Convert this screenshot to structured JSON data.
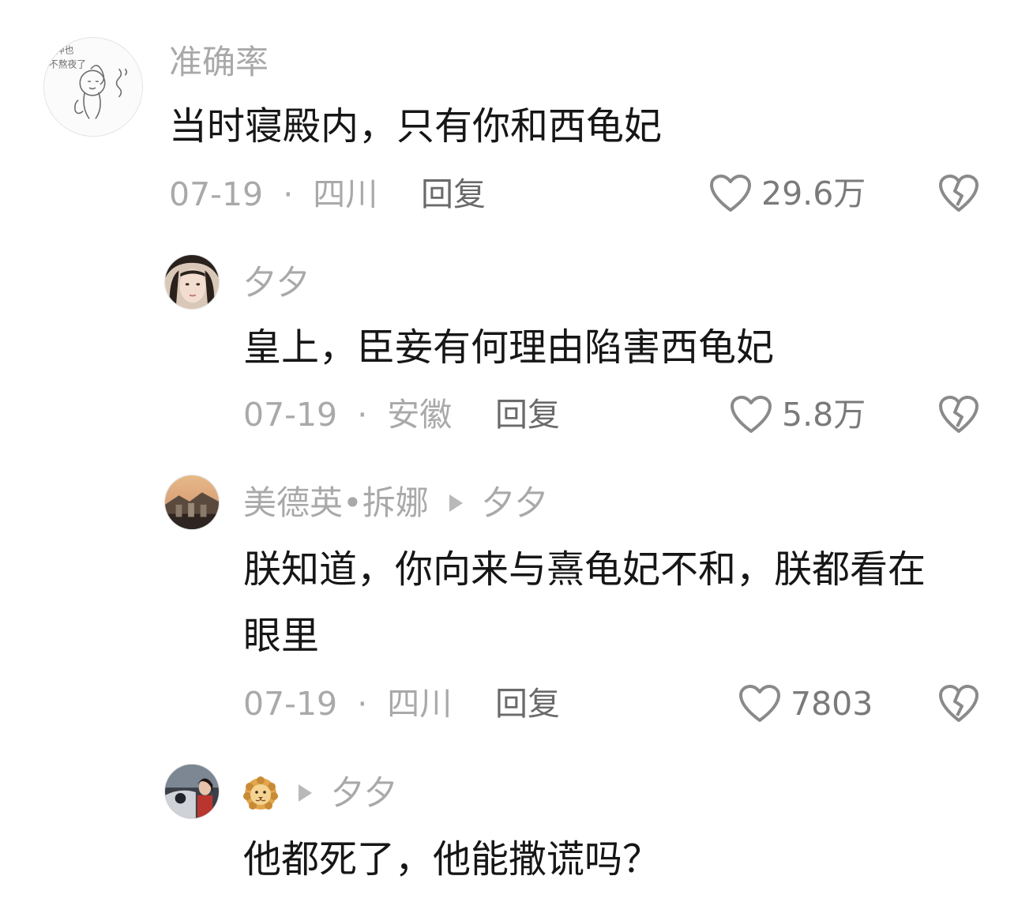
{
  "comments": [
    {
      "username": "准确率",
      "content": "当时寝殿内，只有你和西龟妃",
      "date": "07-19",
      "location": "四川",
      "reply_label": "回复",
      "likes": "29.6万"
    },
    {
      "username": "夕夕",
      "content": "皇上，臣妾有何理由陷害西龟妃",
      "date": "07-19",
      "location": "安徽",
      "reply_label": "回复",
      "likes": "5.8万"
    },
    {
      "username": "美德英•拆娜",
      "reply_to": "夕夕",
      "content_line1": "朕知道，你向来与熹龟妃不和，朕都看在",
      "content_line2": "眼里",
      "date": "07-19",
      "location": "四川",
      "reply_label": "回复",
      "likes": "7803"
    },
    {
      "username_icon": "lion-emoji",
      "reply_to": "夕夕",
      "content": "他都死了，他能撒谎吗？"
    }
  ],
  "separator": "·",
  "colors": {
    "meta_gray": "#a9a9a9",
    "reply_gray": "#6a6a6a",
    "text": "#161616"
  }
}
